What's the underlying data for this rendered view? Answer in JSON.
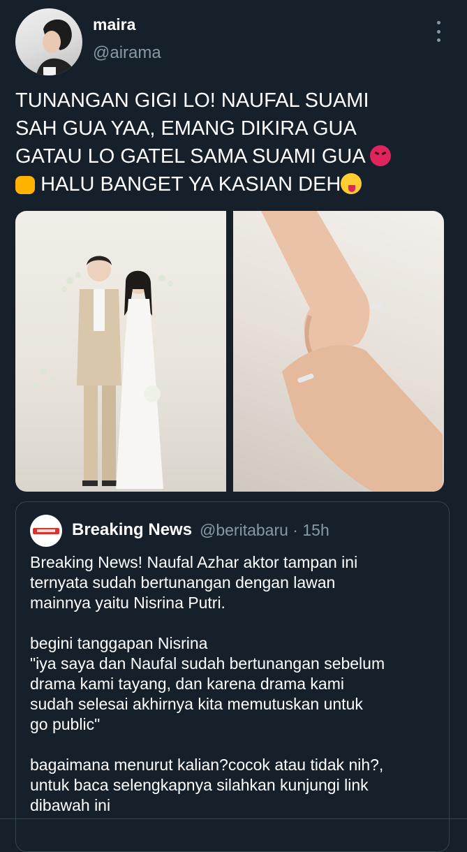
{
  "tweet": {
    "display_name": "maira",
    "handle": "@airama",
    "line1": "TUNANGAN GIGI LO! NAUFAL SUAMI",
    "line2": "SAH GUA YAA, EMANG DIKIRA GUA",
    "line3": "GATAU LO GATEL SAMA SUAMI GUA",
    "line4": "HALU BANGET YA KASIAN DEH",
    "emojis": [
      "angry-face",
      "oncoming-fist",
      "zany-face"
    ]
  },
  "quoted": {
    "display_name": "Breaking News",
    "meta": "@beritabaru · 15h",
    "para1": "Breaking News! Naufal Azhar aktor tampan ini\nternyata sudah bertunangan dengan lawan\nmainnya yaitu Nisrina Putri.",
    "para2": "begini tanggapan Nisrina\n\"iya saya dan Naufal sudah bertunangan sebelum\ndrama kami tayang, dan karena drama kami\nsudah selesai akhirnya kita memutuskan untuk\ngo public\"",
    "para3": "bagaimana menurut kalian?cocok atau tidak nih?,\nuntuk baca selengkapnya silahkan kunjungi link\ndibawah ini"
  },
  "colors": {
    "background": "#15202b",
    "secondary_text": "#8899a6",
    "border": "#38444d"
  }
}
